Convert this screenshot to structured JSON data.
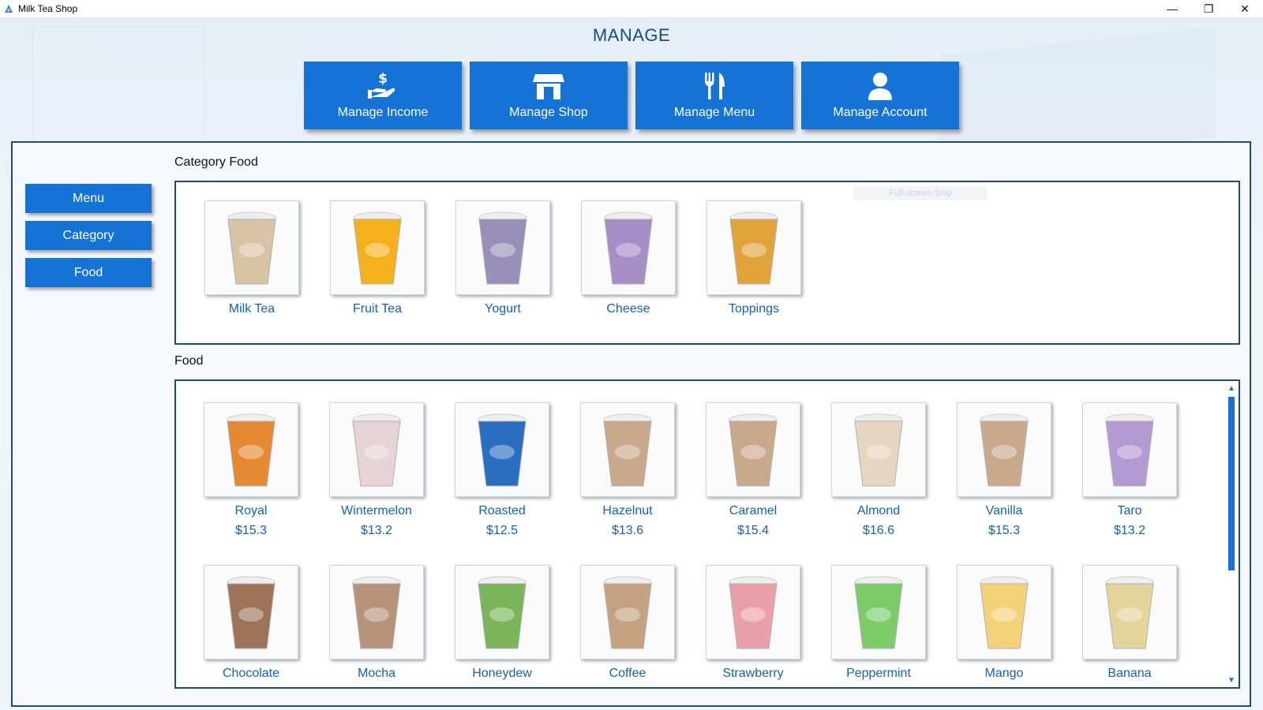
{
  "window": {
    "title": "Milk Tea Shop"
  },
  "heading": "MANAGE",
  "top_nav": [
    {
      "label": "Manage Income",
      "icon": "money-hand-icon"
    },
    {
      "label": "Manage Shop",
      "icon": "shop-icon"
    },
    {
      "label": "Manage Menu",
      "icon": "fork-knife-icon"
    },
    {
      "label": "Manage Account",
      "icon": "user-icon"
    }
  ],
  "side_nav": [
    {
      "label": "Menu"
    },
    {
      "label": "Category"
    },
    {
      "label": "Food"
    }
  ],
  "category_section": {
    "label": "Category Food",
    "items": [
      {
        "name": "Milk Tea",
        "color": "#d9c3a6"
      },
      {
        "name": "Fruit Tea",
        "color": "#f5b11c"
      },
      {
        "name": "Yogurt",
        "color": "#9a8fb8"
      },
      {
        "name": "Cheese",
        "color": "#a88ec6"
      },
      {
        "name": "Toppings",
        "color": "#e2a33a"
      }
    ]
  },
  "food_section": {
    "label": "Food",
    "items": [
      {
        "name": "Royal",
        "price": "$15.3",
        "color": "#e58a33"
      },
      {
        "name": "Wintermelon",
        "price": "$13.2",
        "color": "#e6d3d8"
      },
      {
        "name": "Roasted",
        "price": "$12.5",
        "color": "#2a6fbf"
      },
      {
        "name": "Hazelnut",
        "price": "$13.6",
        "color": "#c9a98c"
      },
      {
        "name": "Caramel",
        "price": "$15.4",
        "color": "#c9a98c"
      },
      {
        "name": "Almond",
        "price": "$16.6",
        "color": "#e6d5c0"
      },
      {
        "name": "Vanilla",
        "price": "$15.3",
        "color": "#c9a98c"
      },
      {
        "name": "Taro",
        "price": "$13.2",
        "color": "#b49ad3"
      },
      {
        "name": "Chocolate",
        "color": "#9c7458"
      },
      {
        "name": "Mocha",
        "color": "#b8937c"
      },
      {
        "name": "Honeydew",
        "color": "#7cb45a"
      },
      {
        "name": "Coffee",
        "color": "#c4a282"
      },
      {
        "name": "Strawberry",
        "color": "#eaa0a8"
      },
      {
        "name": "Peppermint",
        "color": "#7ccc6a"
      },
      {
        "name": "Mango",
        "color": "#f3d27a"
      },
      {
        "name": "Banana",
        "color": "#e3d59c"
      }
    ]
  },
  "overlay_hint": "Full-screen Snip"
}
